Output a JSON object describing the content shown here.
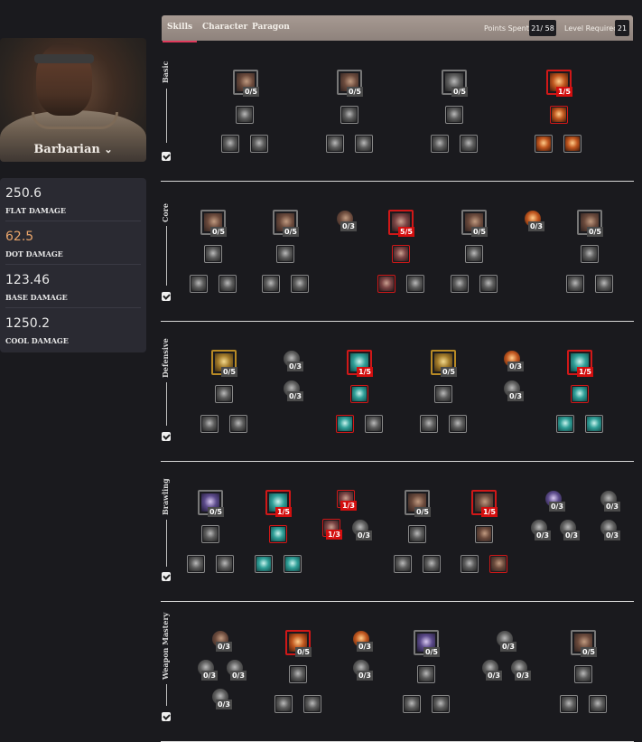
{
  "hero": {
    "class_name": "Barbarian",
    "chevron": "⌄"
  },
  "stats": [
    {
      "value": "250.6",
      "label": "FLAT DAMAGE",
      "color": "#e8e8e8"
    },
    {
      "value": "62.5",
      "label": "DOT DAMAGE",
      "color": "#e8a46b"
    },
    {
      "value": "123.46",
      "label": "BASE DAMAGE",
      "color": "#e8e8e8"
    },
    {
      "value": "1250.2",
      "label": "COOL DAMAGE",
      "color": "#e8e8e8"
    }
  ],
  "tabs": [
    {
      "label": "Skills",
      "active": true
    },
    {
      "label": "Character",
      "active": false
    },
    {
      "label": "Paragon",
      "active": false
    }
  ],
  "points": {
    "label": "Points Spent",
    "value": "21/ 58"
  },
  "level": {
    "label": "Level Required",
    "value": "21"
  },
  "sections": [
    {
      "name": "Basic"
    },
    {
      "name": "Core"
    },
    {
      "name": "Defensive"
    },
    {
      "name": "Brawling"
    },
    {
      "name": "Weapon Mastery"
    }
  ],
  "colors": {
    "accent": "#e03a5c",
    "selected_border": "#d01818",
    "rank_badge_active": "#d40f0f"
  },
  "icons": {
    "check": "checkbox-checked-icon",
    "chevron": "chevron-down-icon"
  }
}
